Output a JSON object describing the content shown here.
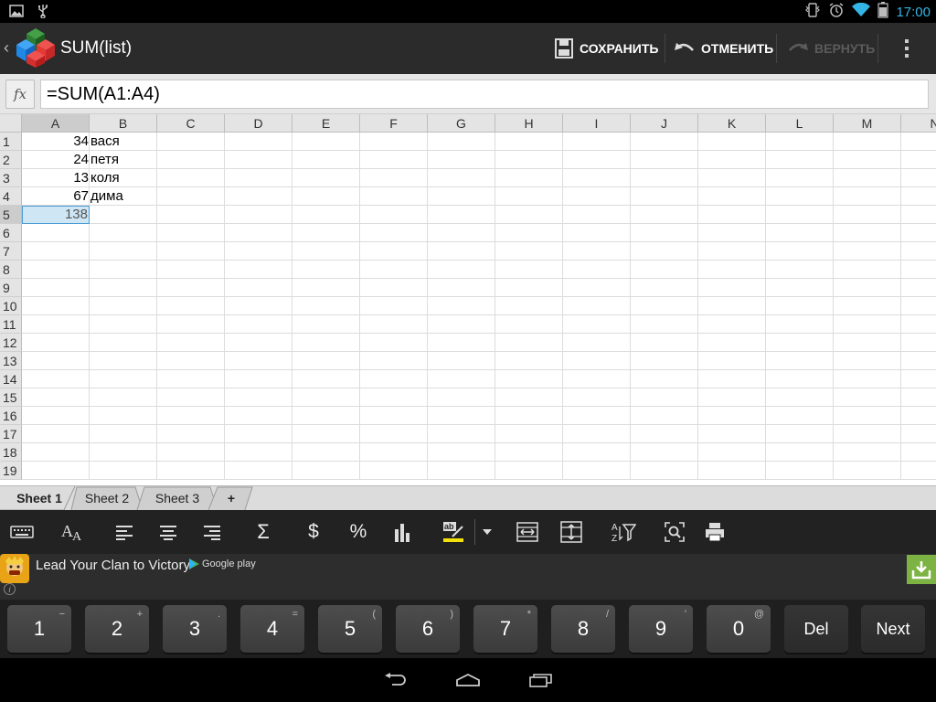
{
  "status": {
    "time": "17:00"
  },
  "app": {
    "title": "SUM(list)"
  },
  "actions": {
    "save": "СОХРАНИТЬ",
    "undo": "ОТМЕНИТЬ",
    "redo": "ВЕРНУТЬ"
  },
  "formula": {
    "fx": "fx",
    "value": "=SUM(A1:A4)"
  },
  "grid": {
    "columns": [
      "A",
      "B",
      "C",
      "D",
      "E",
      "F",
      "G",
      "H",
      "I",
      "J",
      "K",
      "L",
      "M",
      "N"
    ],
    "rows": [
      "1",
      "2",
      "3",
      "4",
      "5",
      "6",
      "7",
      "8",
      "9",
      "10",
      "11",
      "12",
      "13",
      "14",
      "15",
      "16",
      "17",
      "18",
      "19"
    ],
    "selected": {
      "row": 5,
      "col": "A"
    },
    "cells": [
      {
        "row": 1,
        "col": "A",
        "value": "34",
        "align": "right"
      },
      {
        "row": 1,
        "col": "B",
        "value": "вася",
        "align": "left"
      },
      {
        "row": 2,
        "col": "A",
        "value": "24",
        "align": "right"
      },
      {
        "row": 2,
        "col": "B",
        "value": "петя",
        "align": "left"
      },
      {
        "row": 3,
        "col": "A",
        "value": "13",
        "align": "right"
      },
      {
        "row": 3,
        "col": "B",
        "value": "коля",
        "align": "left"
      },
      {
        "row": 4,
        "col": "A",
        "value": "67",
        "align": "right"
      },
      {
        "row": 4,
        "col": "B",
        "value": "дима",
        "align": "left"
      },
      {
        "row": 5,
        "col": "A",
        "value": "138",
        "align": "right"
      }
    ]
  },
  "sheets": [
    {
      "label": "Sheet 1",
      "active": true
    },
    {
      "label": "Sheet 2",
      "active": false
    },
    {
      "label": "Sheet 3",
      "active": false
    },
    {
      "label": "+",
      "active": false
    }
  ],
  "toolbar": {
    "icons": [
      "keyboard-icon",
      "font-size-icon",
      "align-left-icon",
      "align-center-icon",
      "align-right-icon",
      "sum-icon",
      "currency-icon",
      "percent-icon",
      "chart-icon",
      "highlight-icon",
      "dropdown-arrow-icon",
      "column-width-icon",
      "row-height-icon",
      "sort-filter-icon",
      "find-icon",
      "print-icon"
    ],
    "sum": "Σ",
    "currency": "$",
    "percent": "%",
    "sort_a": "A",
    "sort_z": "Z",
    "highlight_ab": "ab"
  },
  "ad": {
    "text": "Lead Your Clan to Victory",
    "store": "Google play",
    "info": "i"
  },
  "keypad": {
    "keys": [
      {
        "label": "1",
        "hint": "−"
      },
      {
        "label": "2",
        "hint": "+"
      },
      {
        "label": "3",
        "hint": "."
      },
      {
        "label": "4",
        "hint": "="
      },
      {
        "label": "5",
        "hint": "("
      },
      {
        "label": "6",
        "hint": ")"
      },
      {
        "label": "7",
        "hint": "*"
      },
      {
        "label": "8",
        "hint": "/"
      },
      {
        "label": "9",
        "hint": "'"
      },
      {
        "label": "0",
        "hint": "@"
      }
    ],
    "del": "Del",
    "next": "Next"
  },
  "colors": {
    "accent": "#33b5e5",
    "selection": "#cfe6f5",
    "selection_border": "#4a9bd5",
    "selected_text": "#555555"
  }
}
